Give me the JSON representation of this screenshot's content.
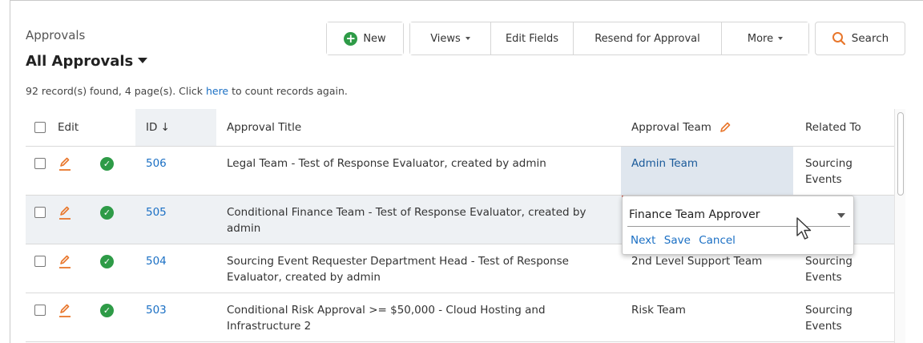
{
  "header": {
    "breadcrumb": "Approvals",
    "title": "All Approvals",
    "records_prefix": "92 record(s) found, 4 page(s). Click ",
    "records_link": "here",
    "records_suffix": " to count records again."
  },
  "toolbar": {
    "new_label": "New",
    "views_label": "Views",
    "edit_fields_label": "Edit Fields",
    "resend_label": "Resend for Approval",
    "more_label": "More",
    "search_label": "Search"
  },
  "table": {
    "columns": {
      "edit": "Edit",
      "id": "ID ↓",
      "title": "Approval Title",
      "team": "Approval Team",
      "related": "Related To"
    },
    "rows": [
      {
        "id": "506",
        "title": "Legal Team - Test of Response Evaluator, created by admin",
        "team": "Admin Team",
        "related": "Sourcing Events"
      },
      {
        "id": "505",
        "title": "Conditional Finance Team - Test of Response Evaluator, created by admin",
        "team": "",
        "related": ""
      },
      {
        "id": "504",
        "title": "Sourcing Event Requester Department Head - Test of Response Evaluator, created by admin",
        "team": "2nd Level Support Team",
        "related": "Sourcing Events"
      },
      {
        "id": "503",
        "title": "Conditional Risk Approval >= $50,000 - Cloud Hosting and Infrastructure 2",
        "team": "Risk Team",
        "related": "Sourcing Events"
      }
    ]
  },
  "inline_editor": {
    "selected_value": "Finance Team Approver",
    "next_label": "Next",
    "save_label": "Save",
    "cancel_label": "Cancel"
  },
  "colors": {
    "accent_green": "#2e9b47",
    "link_blue": "#1a6fc4",
    "edit_orange": "#e8762b"
  }
}
